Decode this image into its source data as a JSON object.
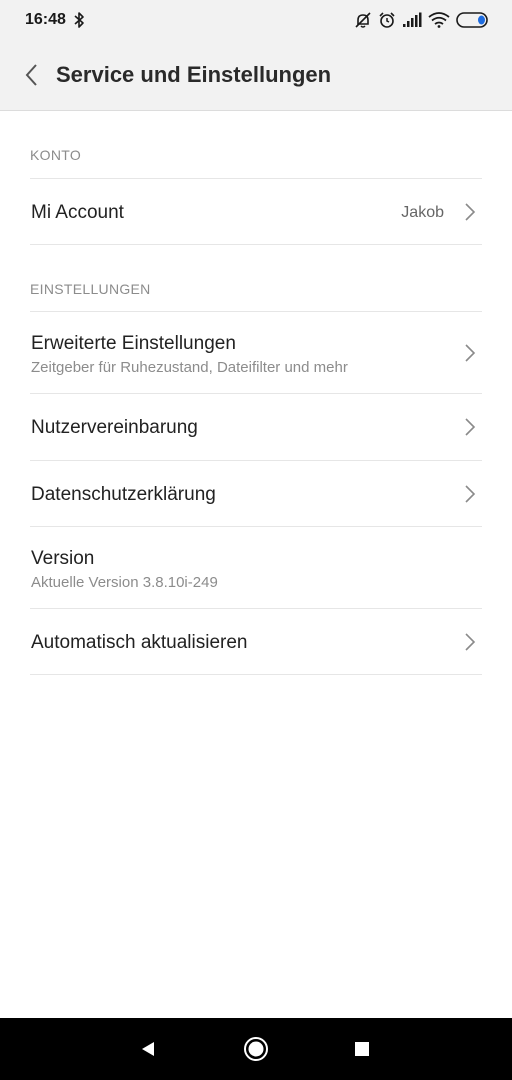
{
  "status_bar": {
    "time": "16:48",
    "icons": [
      "bluetooth-icon",
      "mute-icon",
      "alarm-icon",
      "signal-icon",
      "wifi-icon",
      "battery-icon"
    ]
  },
  "header": {
    "title": "Service und Einstellungen",
    "back_icon": "chevron-left-icon"
  },
  "sections": {
    "konto": {
      "header": "KONTO",
      "mi_account": {
        "title": "Mi Account",
        "value": "Jakob"
      }
    },
    "einstellungen": {
      "header": "EINSTELLUNGEN",
      "advanced": {
        "title": "Erweiterte Einstellungen",
        "subtitle": "Zeitgeber für Ruhezustand, Dateifilter und mehr"
      },
      "user_agreement": {
        "title": "Nutzervereinbarung"
      },
      "privacy": {
        "title": "Datenschutzerklärung"
      },
      "version": {
        "title": "Version",
        "subtitle": "Aktuelle Version 3.8.10i-249"
      },
      "auto_update": {
        "title": "Automatisch aktualisieren"
      }
    }
  },
  "nav_bar": {
    "buttons": [
      "back-triangle-icon",
      "home-circle-icon",
      "recents-square-icon"
    ]
  },
  "colors": {
    "header_bg": "#f2f2f2",
    "text_primary": "#222222",
    "text_secondary": "#8c8c8c",
    "divider": "#e6e6e6",
    "battery_accent": "#1e6ce0"
  }
}
